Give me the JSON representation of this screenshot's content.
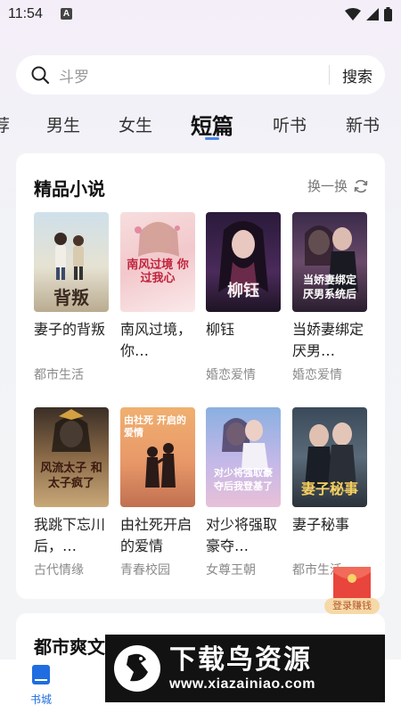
{
  "status_bar": {
    "time": "11:54",
    "notification_badge": "A"
  },
  "search": {
    "placeholder": "斗罗",
    "button_label": "搜索"
  },
  "tabs": [
    {
      "label": "荐",
      "active": false
    },
    {
      "label": "男生",
      "active": false
    },
    {
      "label": "女生",
      "active": false
    },
    {
      "label": "短篇",
      "active": true
    },
    {
      "label": "听书",
      "active": false
    },
    {
      "label": "新书",
      "active": false
    }
  ],
  "section": {
    "title": "精品小说",
    "refresh_label": "换一换"
  },
  "books": [
    {
      "title": "妻子的背叛",
      "genre": "都市生活",
      "cover_text": "背叛"
    },
    {
      "title": "南风过境，你…",
      "genre": "",
      "cover_text": "南风过境 你过我心"
    },
    {
      "title": "柳钰",
      "genre": "婚恋爱情",
      "cover_text": "柳钰"
    },
    {
      "title": "当娇妻绑定厌男…",
      "genre": "婚恋爱情",
      "cover_text": "当娇妻绑定 厌男系统后"
    },
    {
      "title": "我跳下忘川后，…",
      "genre": "古代情缘",
      "cover_text": "风流太子 和太子疯了"
    },
    {
      "title": "由社死开启的爱情",
      "genre": "青春校园",
      "cover_text": "由社死 开启的爱情"
    },
    {
      "title": "对少将强取豪夺…",
      "genre": "女尊王朝",
      "cover_text": "对少将强取豪 夺后我登基了"
    },
    {
      "title": "妻子秘事",
      "genre": "都市生活",
      "cover_text": "妻子秘事"
    }
  ],
  "section2": {
    "title": "都市爽文"
  },
  "bottom_nav": {
    "home_label": "书城"
  },
  "red_packet": {
    "label": "登录赚钱"
  },
  "watermark": {
    "title": "下载鸟资源",
    "url": "www.xiazainiao.com"
  },
  "colors": {
    "accent": "#1f6de0",
    "tab_underline": "#4a86e8",
    "red_packet": "#e8453c"
  }
}
